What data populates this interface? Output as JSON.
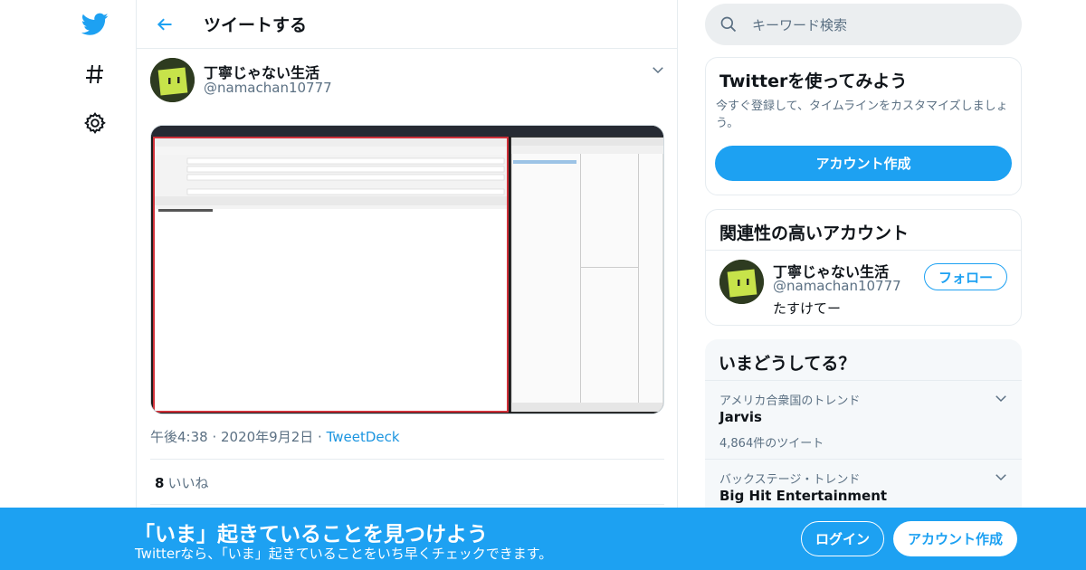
{
  "nav": {
    "logo_icon": "twitter-bird-icon",
    "explore_icon": "hashtag-icon",
    "settings_icon": "gear-icon"
  },
  "header": {
    "title": "ツイートする",
    "back_icon": "arrow-left-icon"
  },
  "tweet": {
    "author_name": "丁寧じゃない生活",
    "author_handle": "@namachan10777",
    "time": "午後4:38",
    "date": "2020年9月2日",
    "source": "TweetDeck",
    "likes_count": "8",
    "likes_label": "いいね"
  },
  "search": {
    "placeholder": "キーワード検索"
  },
  "signup_card": {
    "title": "Twitterを使ってみよう",
    "description": "今すぐ登録して、タイムラインをカスタマイズしましょう。",
    "button_label": "アカウント作成"
  },
  "related_card": {
    "title": "関連性の高いアカウント",
    "name": "丁寧じゃない生活",
    "handle": "@namachan10777",
    "bio": "たすけてー",
    "follow_label": "フォロー"
  },
  "trends": {
    "title": "いまどうしてる？",
    "items": [
      {
        "context": "アメリカ合衆国のトレンド",
        "name": "Jarvis",
        "count": "4,864件のツイート"
      },
      {
        "context": "バックステージ・トレンド",
        "name": "Big Hit Entertainment",
        "count": ""
      }
    ]
  },
  "banner": {
    "title": "「いま」起きていることを見つけよう",
    "subtitle": "Twitterなら、「いま」起きていることをいち早くチェックできます。",
    "login_label": "ログイン",
    "signup_label": "アカウント作成"
  },
  "colors": {
    "brand": "#1da1f2",
    "text_muted": "#5b7083",
    "border": "#e6ecf0"
  }
}
